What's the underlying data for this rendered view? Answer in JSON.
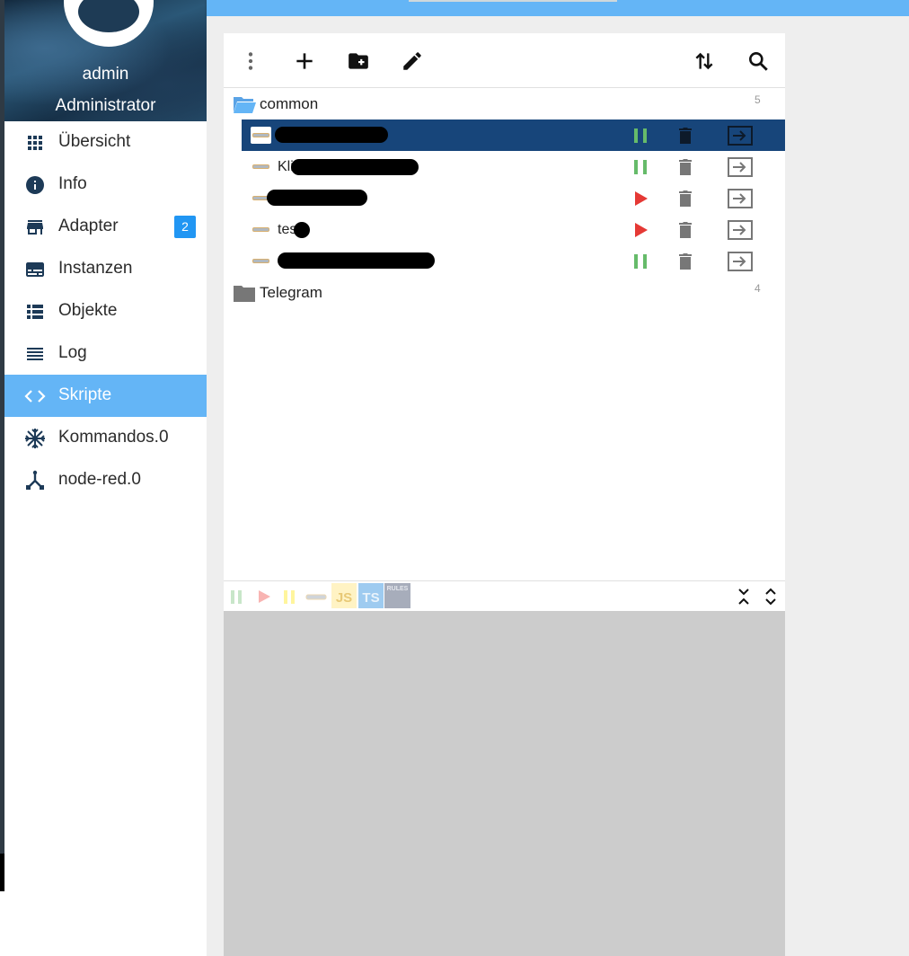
{
  "profile": {
    "name": "admin",
    "role": "Administrator"
  },
  "nav": {
    "items": [
      {
        "label": "Übersicht",
        "icon": "apps-grid-icon"
      },
      {
        "label": "Info",
        "icon": "info-icon"
      },
      {
        "label": "Adapter",
        "icon": "store-icon",
        "badge": "2"
      },
      {
        "label": "Instanzen",
        "icon": "instances-icon"
      },
      {
        "label": "Objekte",
        "icon": "list-icon"
      },
      {
        "label": "Log",
        "icon": "log-lines-icon"
      },
      {
        "label": "Skripte",
        "icon": "code-icon",
        "active": true
      },
      {
        "label": "Kommandos.0",
        "icon": "snowflake-icon"
      },
      {
        "label": "node-red.0",
        "icon": "node-red-icon"
      }
    ]
  },
  "toolbar": {
    "buttons": [
      "more-vert-icon",
      "add-icon",
      "new-folder-icon",
      "edit-icon",
      "sort-icon",
      "search-icon"
    ]
  },
  "tree": {
    "folders": [
      {
        "label": "common",
        "count": "5",
        "open": true
      },
      {
        "label": "Telegram",
        "count": "4",
        "open": false
      }
    ],
    "scripts": [
      {
        "name": "",
        "state": "running",
        "selected": true
      },
      {
        "name": "Klingel…Test",
        "state": "running",
        "selected": false
      },
      {
        "name": "",
        "state": "stopped",
        "selected": false
      },
      {
        "name": "test",
        "state": "stopped",
        "selected": false
      },
      {
        "name": "",
        "state": "running",
        "selected": false
      }
    ]
  },
  "filterbar": {
    "js_label": "JS",
    "ts_label": "TS",
    "rules_label": "RULES"
  },
  "colors": {
    "accent": "#64b5f6",
    "selected_row": "#17457a",
    "running": "#66bb6a",
    "stopped": "#e53935",
    "badge": "#2196f3"
  }
}
